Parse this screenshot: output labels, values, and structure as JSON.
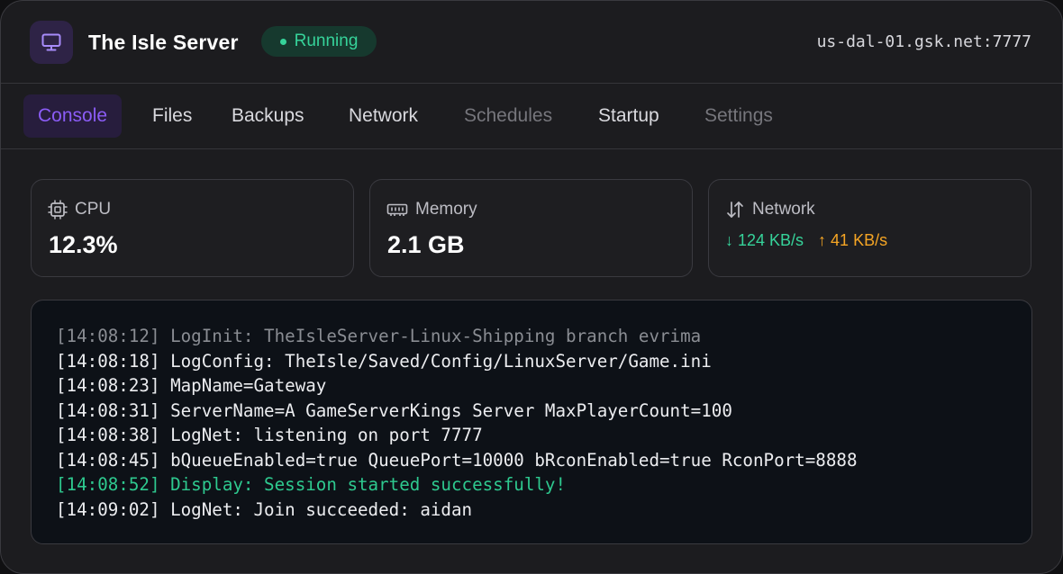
{
  "header": {
    "title": "The Isle Server",
    "status": "Running",
    "address": "us-dal-01.gsk.net:7777",
    "app_icon": "monitor-icon"
  },
  "tabs": [
    {
      "label": "Console",
      "state": "active"
    },
    {
      "label": "Files",
      "state": "normal"
    },
    {
      "label": "Backups",
      "state": "normal"
    },
    {
      "label": "Network",
      "state": "normal"
    },
    {
      "label": "Schedules",
      "state": "disabled"
    },
    {
      "label": "Startup",
      "state": "normal"
    },
    {
      "label": "Settings",
      "state": "disabled"
    }
  ],
  "stats": {
    "cpu": {
      "label": "CPU",
      "value": "12.3%",
      "icon": "cpu-icon"
    },
    "memory": {
      "label": "Memory",
      "value": "2.1 GB",
      "icon": "memory-icon"
    },
    "network": {
      "label": "Network",
      "down": "↓ 124 KB/s",
      "up": "↑ 41 KB/s",
      "icon": "transfer-arrows-icon"
    }
  },
  "console": {
    "lines": [
      {
        "text": "[14:08:12] LogInit: TheIsleServer-Linux-Shipping branch evrima",
        "style": "muted"
      },
      {
        "text": "[14:08:18] LogConfig: TheIsle/Saved/Config/LinuxServer/Game.ini",
        "style": "normal"
      },
      {
        "text": "[14:08:23] MapName=Gateway",
        "style": "normal"
      },
      {
        "text": "[14:08:31] ServerName=A GameServerKings Server MaxPlayerCount=100",
        "style": "normal"
      },
      {
        "text": "[14:08:38] LogNet: listening on port 7777",
        "style": "normal"
      },
      {
        "text": "[14:08:45] bQueueEnabled=true QueuePort=10000 bRconEnabled=true RconPort=8888",
        "style": "normal"
      },
      {
        "text": "[14:08:52] Display: Session started successfully!",
        "style": "success"
      },
      {
        "text": "[14:09:02] LogNet: Join succeeded: aidan",
        "style": "normal"
      }
    ]
  },
  "colors": {
    "accent": "#8b5cf6",
    "success": "#36d39a",
    "warning": "#f5a524",
    "background": "#1c1c1f",
    "console_background": "#0d1117"
  }
}
